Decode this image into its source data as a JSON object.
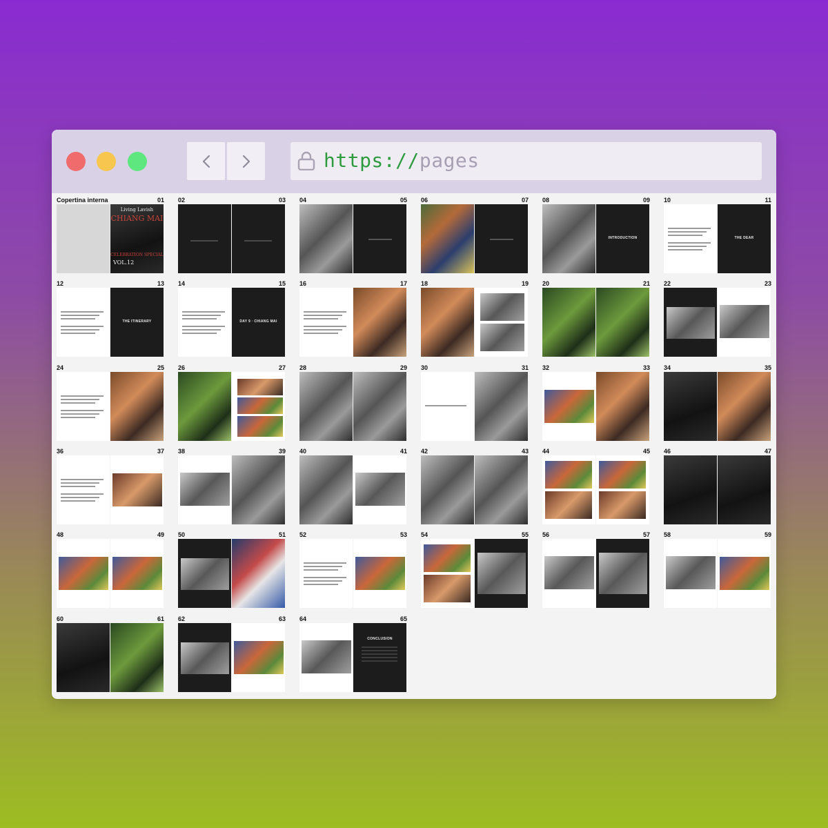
{
  "browser": {
    "url_scheme": "https://",
    "url_host": "pages",
    "back_icon": "chevron-left-icon",
    "forward_icon": "chevron-right-icon",
    "lock_icon": "lock-icon"
  },
  "cover": {
    "title_script": "Living Lavish",
    "title_main": "CHIANG MAI",
    "subtitle": "CELEBRATION SPECIAL",
    "volume": "VOL.12"
  },
  "page_titles": {
    "introduction": "INTRODUCTION",
    "the_dear": "THE DEAR",
    "the_itinerary": "THE ITINERARY",
    "day_chiang_mai": "DAY 9 · CHIANG MAI",
    "conclusion": "CONCLUSION"
  },
  "spreads": [
    {
      "left": "Copertina interna",
      "right": "01"
    },
    {
      "left": "02",
      "right": "03"
    },
    {
      "left": "04",
      "right": "05"
    },
    {
      "left": "06",
      "right": "07"
    },
    {
      "left": "08",
      "right": "09"
    },
    {
      "left": "10",
      "right": "11"
    },
    {
      "left": "12",
      "right": "13"
    },
    {
      "left": "14",
      "right": "15"
    },
    {
      "left": "16",
      "right": "17"
    },
    {
      "left": "18",
      "right": "19"
    },
    {
      "left": "20",
      "right": "21"
    },
    {
      "left": "22",
      "right": "23"
    },
    {
      "left": "24",
      "right": "25"
    },
    {
      "left": "26",
      "right": "27"
    },
    {
      "left": "28",
      "right": "29"
    },
    {
      "left": "30",
      "right": "31"
    },
    {
      "left": "32",
      "right": "33"
    },
    {
      "left": "34",
      "right": "35"
    },
    {
      "left": "36",
      "right": "37"
    },
    {
      "left": "38",
      "right": "39"
    },
    {
      "left": "40",
      "right": "41"
    },
    {
      "left": "42",
      "right": "43"
    },
    {
      "left": "44",
      "right": "45"
    },
    {
      "left": "46",
      "right": "47"
    },
    {
      "left": "48",
      "right": "49"
    },
    {
      "left": "50",
      "right": "51"
    },
    {
      "left": "52",
      "right": "53"
    },
    {
      "left": "54",
      "right": "55"
    },
    {
      "left": "56",
      "right": "57"
    },
    {
      "left": "58",
      "right": "59"
    },
    {
      "left": "60",
      "right": "61"
    },
    {
      "left": "62",
      "right": "63"
    },
    {
      "left": "64",
      "right": "65"
    }
  ]
}
